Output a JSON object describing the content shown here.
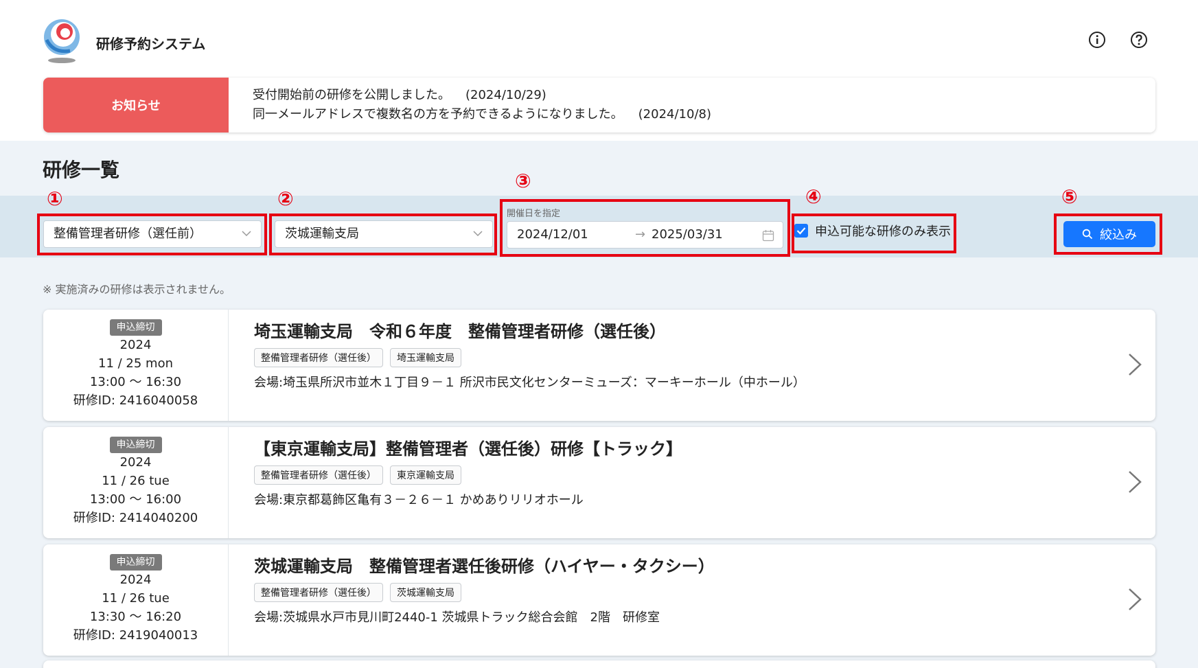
{
  "app": {
    "title": "研修予約システム"
  },
  "notice": {
    "label": "お知らせ",
    "items": [
      {
        "text": "受付開始前の研修を公開しました。",
        "date": "(2024/10/29)"
      },
      {
        "text": "同一メールアドレスで複数名の方を予約できるようになりました。",
        "date": "(2024/10/8)"
      }
    ]
  },
  "section": {
    "title": "研修一覧"
  },
  "markers": [
    "①",
    "②",
    "③",
    "④",
    "⑤"
  ],
  "filters": {
    "training_type": "整備管理者研修（選任前）",
    "office": "茨城運輸支局",
    "date_caption": "開催日を指定",
    "date_start": "2024/12/01",
    "date_arrow": "→",
    "date_end": "2025/03/31",
    "available_only_label": "申込可能な研修のみ表示",
    "available_only_checked": true,
    "search_label": "絞込み"
  },
  "note": "※ 実施済みの研修は表示されません。",
  "trainings": [
    {
      "status": "申込締切",
      "year": "2024",
      "date": "11 / 25  mon",
      "time": "13:00 ～ 16:30",
      "id_line": "研修ID: 2416040058",
      "title": "埼玉運輸支局　令和６年度　整備管理者研修（選任後）",
      "tags": [
        "整備管理者研修（選任後）",
        "埼玉運輸支局"
      ],
      "venue": "会場:埼玉県所沢市並木１丁目９－１ 所沢市民文化センターミューズ：マーキーホール（中ホール）"
    },
    {
      "status": "申込締切",
      "year": "2024",
      "date": "11 / 26  tue",
      "time": "13:00 ～ 16:00",
      "id_line": "研修ID: 2414040200",
      "title": "【東京運輸支局】整備管理者（選任後）研修【トラック】",
      "tags": [
        "整備管理者研修（選任後）",
        "東京運輸支局"
      ],
      "venue": "会場:東京都葛飾区亀有３－２６－１ かめありリリオホール"
    },
    {
      "status": "申込締切",
      "year": "2024",
      "date": "11 / 26  tue",
      "time": "13:30 ～ 16:20",
      "id_line": "研修ID: 2419040013",
      "title": "茨城運輸支局　整備管理者選任後研修（ハイヤー・タクシー）",
      "tags": [
        "整備管理者研修（選任後）",
        "茨城運輸支局"
      ],
      "venue": "会場:茨城県水戸市見川町2440-1 茨城県トラック総合会館　2階　研修室"
    }
  ]
}
